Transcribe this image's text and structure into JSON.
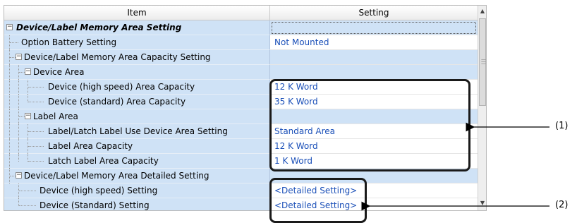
{
  "header": {
    "item": "Item",
    "setting": "Setting"
  },
  "rows": [
    {
      "label": "Device/Label Memory Area Setting",
      "value": ""
    },
    {
      "label": "Option Battery Setting",
      "value": "Not Mounted"
    },
    {
      "label": "Device/Label Memory Area Capacity Setting",
      "value": ""
    },
    {
      "label": "Device Area",
      "value": ""
    },
    {
      "label": "Device (high speed) Area Capacity",
      "value": "12 K Word"
    },
    {
      "label": "Device (standard) Area Capacity",
      "value": "35 K Word"
    },
    {
      "label": "Label Area",
      "value": ""
    },
    {
      "label": "Label/Latch Label Use Device Area Setting",
      "value": "Standard Area"
    },
    {
      "label": "Label Area Capacity",
      "value": "12 K Word"
    },
    {
      "label": "Latch Label Area Capacity",
      "value": "1 K Word"
    },
    {
      "label": "Device/Label Memory Area Detailed Setting",
      "value": ""
    },
    {
      "label": "Device (high speed) Setting",
      "value": "<Detailed Setting>"
    },
    {
      "label": "Device (Standard) Setting",
      "value": "<Detailed Setting>"
    }
  ],
  "toggle_symbol": "−",
  "callouts": {
    "one": "(1)",
    "two": "(2)"
  },
  "scrollbar": {
    "up": "▲",
    "down": "▼"
  },
  "colors": {
    "row_blue": "#cfe2f6",
    "value_text": "#1a4fb8"
  }
}
